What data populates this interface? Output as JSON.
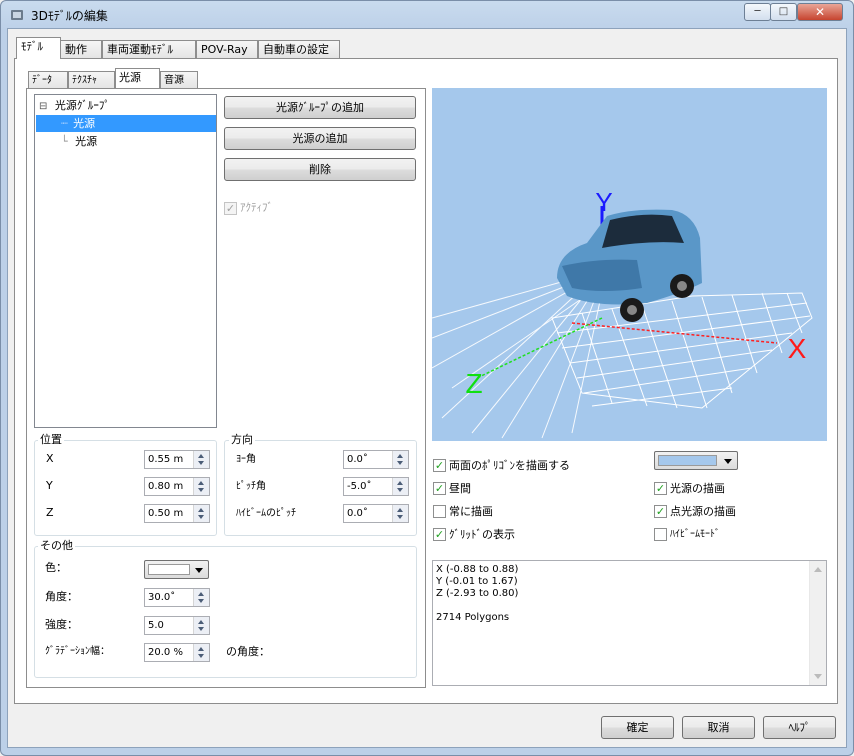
{
  "window": {
    "title": "3Dﾓﾃﾞﾙの編集",
    "minimize_label": "─",
    "maximize_label": "□",
    "close_label": "✕"
  },
  "main_tabs": [
    "ﾓﾃﾞﾙ",
    "動作",
    "車両運動ﾓﾃﾞﾙ",
    "POV-Ray",
    "自動車の設定"
  ],
  "sub_tabs": [
    "ﾃﾞｰﾀ",
    "ﾃｸｽﾁｬ",
    "光源",
    "音源"
  ],
  "tree": {
    "expander": "⊟",
    "group": "光源ｸﾞﾙｰﾌﾟ",
    "item1": "光源",
    "item2": "光源"
  },
  "buttons": {
    "add_group": "光源ｸﾞﾙｰﾌﾟの追加",
    "add_light": "光源の追加",
    "delete": "削除"
  },
  "active_checkbox": {
    "label": "ｱｸﾃｨﾌﾞ",
    "checked": true
  },
  "position": {
    "title": "位置",
    "x_label": "X",
    "x_value": "0.55 m",
    "y_label": "Y",
    "y_value": "0.80 m",
    "z_label": "Z",
    "z_value": "0.50 m"
  },
  "direction": {
    "title": "方向",
    "yaw_label": "ﾖｰ角",
    "yaw_value": "0.0˚",
    "pitch_label": "ﾋﾟｯﾁ角",
    "pitch_value": "-5.0˚",
    "highbeam_label": "ﾊｲﾋﾞｰﾑのﾋﾟｯﾁ",
    "highbeam_value": "0.0˚"
  },
  "other": {
    "title": "その他",
    "color_label": "色：",
    "color_value": "#ffffff",
    "angle_label": "角度：",
    "angle_value": "30.0˚",
    "intensity_label": "強度：",
    "intensity_value": "5.0",
    "gradation_label": "ｸﾞﾗﾃﾞｰｼｮﾝ幅：",
    "gradation_value": "20.0 %",
    "angle2_label": "の角度："
  },
  "viewport": {
    "background": "#a5c8ec",
    "axis_x": "X",
    "axis_y": "Y",
    "axis_z": "Z"
  },
  "options": {
    "double_sided": {
      "label": "両面のﾎﾟﾘｺﾞﾝを描画する",
      "checked": true
    },
    "daytime": {
      "label": "昼間",
      "checked": true
    },
    "always_draw": {
      "label": "常に描画",
      "checked": false
    },
    "show_grid": {
      "label": "ｸﾞﾘｯﾄﾞの表示",
      "checked": true
    },
    "draw_lights": {
      "label": "光源の描画",
      "checked": true
    },
    "draw_point_lights": {
      "label": "点光源の描画",
      "checked": true
    },
    "highbeam_mode": {
      "label": "ﾊｲﾋﾞｰﾑﾓｰﾄﾞ",
      "checked": false
    },
    "bg_color": "#a5c8ec"
  },
  "info": {
    "line1": "X (-0.88 to 0.88)",
    "line2": "Y (-0.01 to 1.67)",
    "line3": "Z (-2.93 to 0.80)",
    "line4": "2714 Polygons"
  },
  "dialog": {
    "ok": "確定",
    "cancel": "取消",
    "help": "ﾍﾙﾌﾟ"
  }
}
